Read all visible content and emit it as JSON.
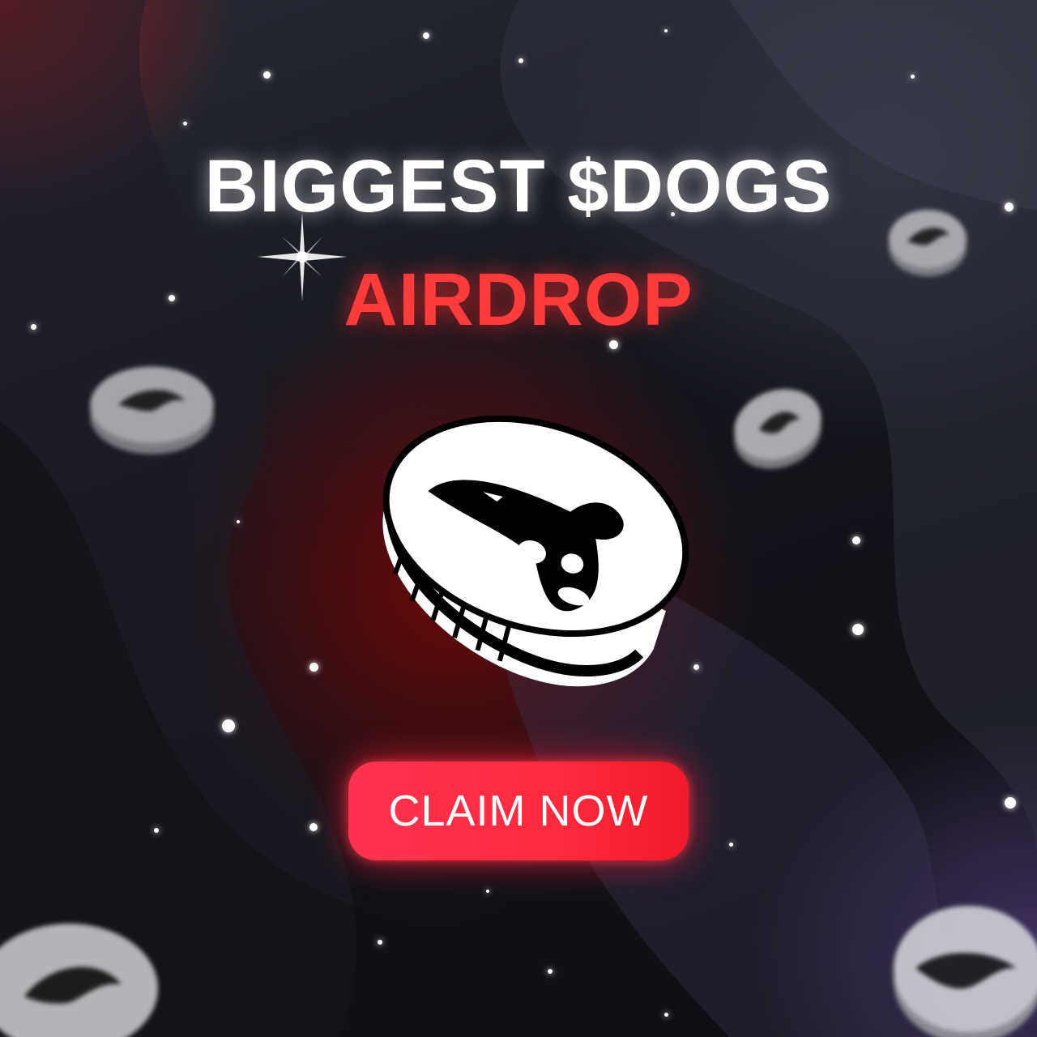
{
  "headline": {
    "line1": "BIGGEST $DOGS",
    "line2": "AIRDROP"
  },
  "cta": {
    "label": "CLAIM NOW"
  },
  "colors": {
    "accent_red": "#ff3b3b",
    "button": "#ff2a3e",
    "text": "#ffffff"
  },
  "icons": [
    "dogs-coin-icon",
    "sparkle-icon",
    "star-icon"
  ]
}
